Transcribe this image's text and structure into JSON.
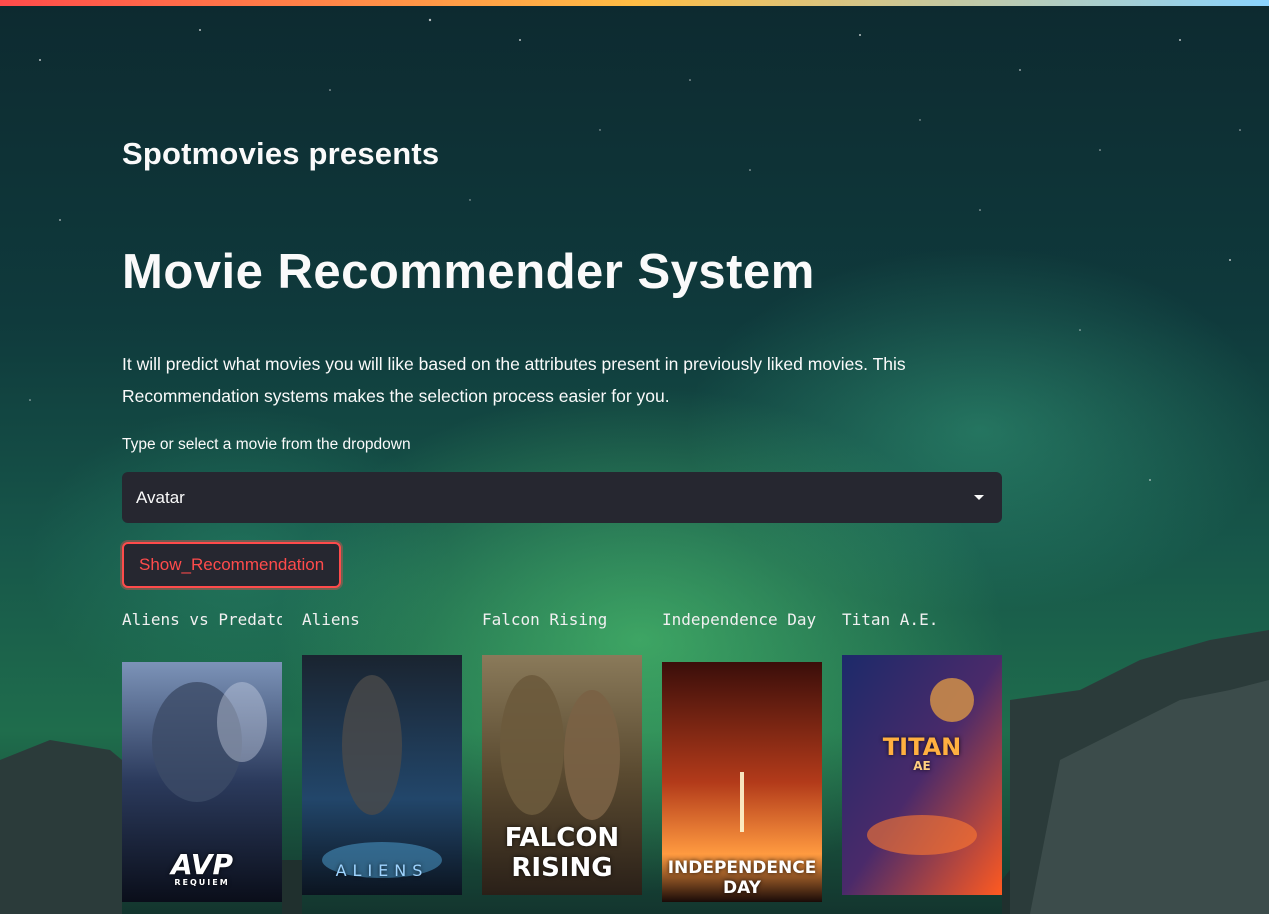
{
  "header": {
    "brand": "Spotmovies presents"
  },
  "main": {
    "title": "Movie Recommender System",
    "description": "It will predict what movies you will like based on the attributes present in previously liked movies. This Recommendation systems makes the selection process easier for you.",
    "select_label": "Type or select a movie from the dropdown",
    "selected_movie": "Avatar",
    "button_label": "Show_Recommendation"
  },
  "recommendations": [
    {
      "title": "Aliens vs Predator: Requiem",
      "poster_text": "AVP",
      "poster_subtext": "REQUIEM"
    },
    {
      "title": "Aliens",
      "poster_text": "ALIENS",
      "poster_subtext": ""
    },
    {
      "title": "Falcon Rising",
      "poster_text": "FALCON RISING",
      "poster_subtext": ""
    },
    {
      "title": "Independence Day",
      "poster_text": "INDEPENDENCE DAY",
      "poster_subtext": ""
    },
    {
      "title": "Titan A.E.",
      "poster_text": "TITAN",
      "poster_subtext": "AE"
    }
  ],
  "colors": {
    "accent": "#ff4b4b",
    "input_bg": "#262730",
    "text": "#fafafa"
  }
}
